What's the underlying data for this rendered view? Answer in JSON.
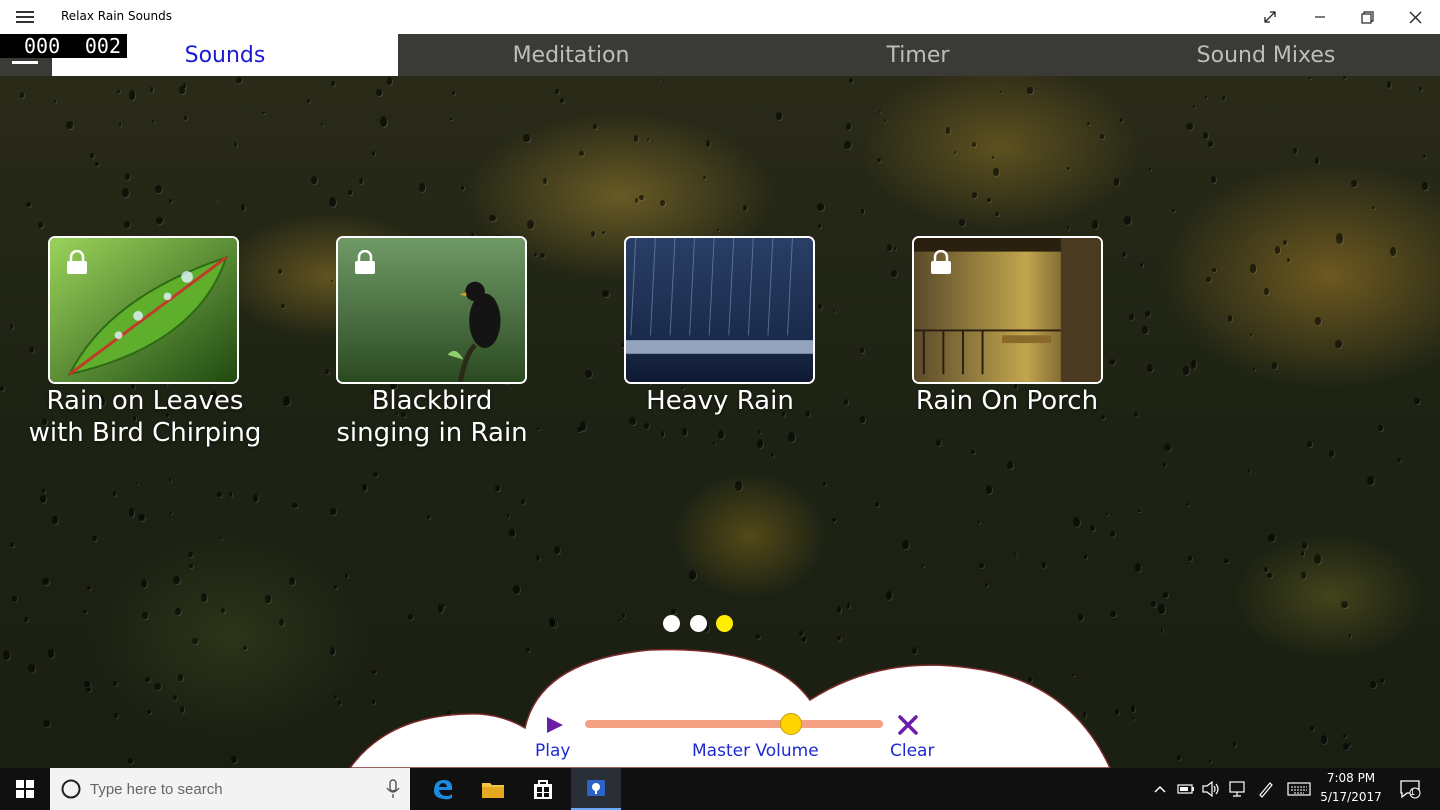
{
  "window": {
    "title": "Relax Rain Sounds",
    "buttons": [
      "expand-icon",
      "minimize-icon",
      "restore-icon",
      "close-icon"
    ]
  },
  "counter": {
    "left": "000",
    "right": "002"
  },
  "tabs": [
    {
      "label": "Sounds",
      "active": true
    },
    {
      "label": "Meditation",
      "active": false
    },
    {
      "label": "Timer",
      "active": false
    },
    {
      "label": "Sound Mixes",
      "active": false
    }
  ],
  "sounds": [
    {
      "title_line1": "Rain on Leaves",
      "title_line2": "with Bird Chirping",
      "locked": true
    },
    {
      "title_line1": "Blackbird",
      "title_line2": "singing in Rain",
      "locked": true
    },
    {
      "title_line1": "Heavy Rain",
      "title_line2": "",
      "locked": false
    },
    {
      "title_line1": "Rain On Porch",
      "title_line2": "",
      "locked": true
    }
  ],
  "pager": {
    "pages": 3,
    "current": 3
  },
  "controls": {
    "play_label": "Play",
    "volume_label": "Master Volume",
    "clear_label": "Clear",
    "volume_level": 0.69
  },
  "taskbar": {
    "search_placeholder": "Type here to search",
    "time": "7:08 PM",
    "date": "5/17/2017",
    "notification_count": "1"
  },
  "colors": {
    "active_tab_text": "#1a1ad6",
    "inactive_tab_text": "#bdbdbd",
    "tabbar_bg": "#3a3b37",
    "control_label": "#1e2ad0",
    "slider_track": "#f4a083",
    "slider_thumb": "#ffd400",
    "active_dot": "#ffee00"
  }
}
